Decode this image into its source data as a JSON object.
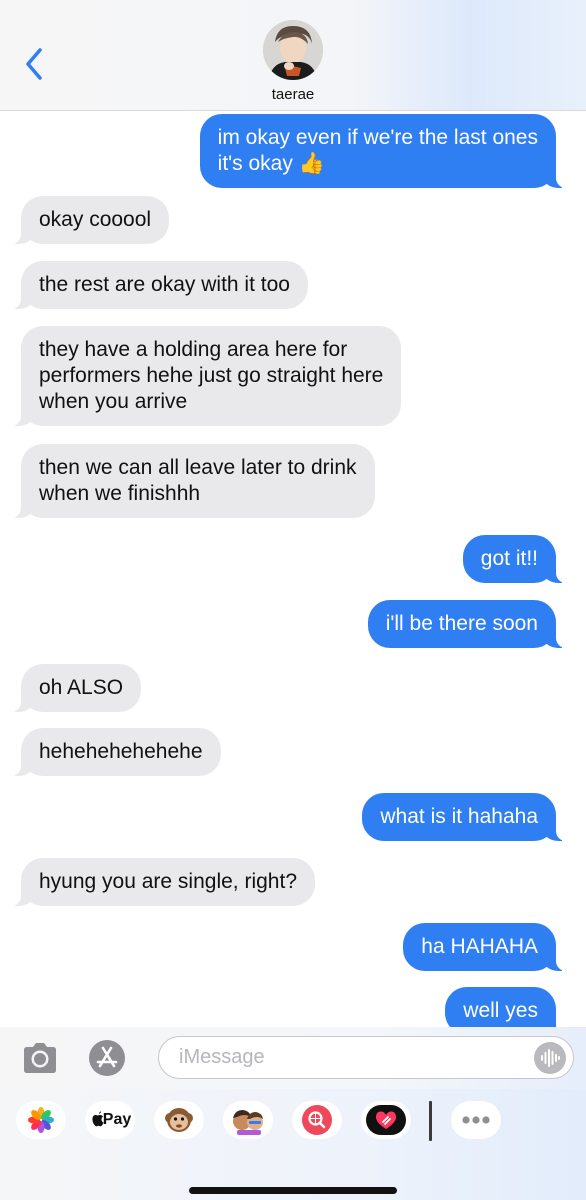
{
  "header": {
    "contact_name": "taerae",
    "back_icon": "chevron-left-icon",
    "avatar_icon": "contact-avatar"
  },
  "messages": [
    {
      "dir": "out",
      "lines": [
        "im okay even if we're the last ones",
        "it's okay 👍"
      ]
    },
    {
      "dir": "in",
      "lines": [
        "okay cooool"
      ]
    },
    {
      "dir": "in",
      "lines": [
        "the rest are okay with it too"
      ]
    },
    {
      "dir": "in",
      "lines": [
        "they have a holding area here for",
        "performers hehe just go straight here",
        "when you arrive"
      ]
    },
    {
      "dir": "in",
      "lines": [
        "then we can all leave later to drink",
        "when we finishhh"
      ]
    },
    {
      "dir": "out",
      "lines": [
        "got it!!"
      ]
    },
    {
      "dir": "out",
      "lines": [
        "i'll be there soon"
      ]
    },
    {
      "dir": "in",
      "lines": [
        "oh ALSO"
      ]
    },
    {
      "dir": "in",
      "lines": [
        "hehehehehehehe"
      ]
    },
    {
      "dir": "out",
      "lines": [
        "what is it hahaha"
      ]
    },
    {
      "dir": "in",
      "lines": [
        "hyung you are single, right?"
      ]
    },
    {
      "dir": "out",
      "lines": [
        "ha HAHAHA"
      ]
    },
    {
      "dir": "out",
      "lines": [
        "well yes"
      ]
    }
  ],
  "input": {
    "placeholder": "iMessage",
    "value": "",
    "camera_icon": "camera-icon",
    "apps_icon": "app-store-icon",
    "audio_icon": "audio-waveform-icon"
  },
  "drawer": {
    "apps": [
      {
        "name": "photos-app-icon"
      },
      {
        "name": "apple-pay-app",
        "label": "Pay"
      },
      {
        "name": "monkey-animoji-icon"
      },
      {
        "name": "memoji-stickers-icon"
      },
      {
        "name": "image-search-icon"
      },
      {
        "name": "digital-touch-heart-icon"
      },
      {
        "name": "more-apps-icon"
      }
    ]
  },
  "colors": {
    "outgoing": "#2f7ff2",
    "incoming": "#e9e9eb",
    "accent": "#2f7ff2"
  }
}
